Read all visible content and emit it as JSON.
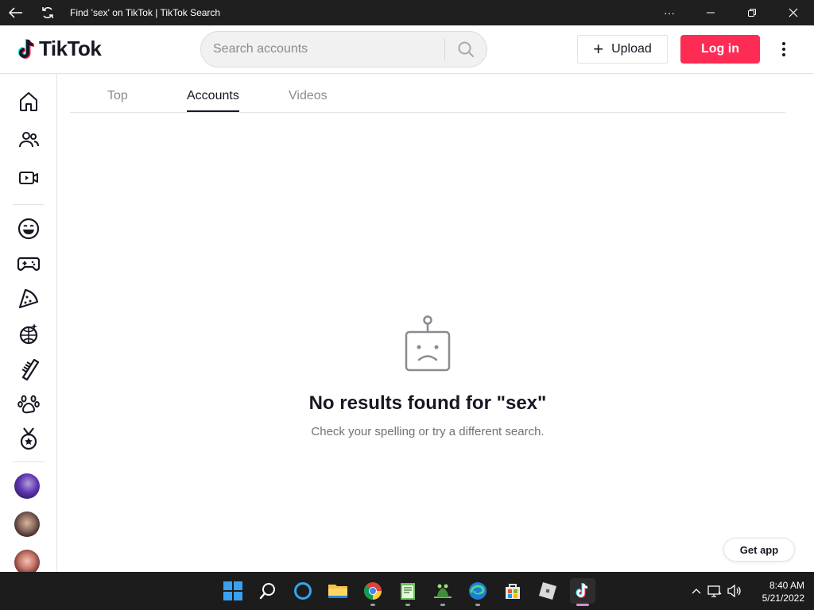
{
  "window": {
    "title": "Find 'sex' on TikTok | TikTok Search"
  },
  "header": {
    "logo_text": "TikTok",
    "search_placeholder": "Search accounts",
    "upload_label": "Upload",
    "login_label": "Log in"
  },
  "tabs": [
    {
      "label": "Top",
      "active": false
    },
    {
      "label": "Accounts",
      "active": true
    },
    {
      "label": "Videos",
      "active": false
    }
  ],
  "sidebar": {
    "items": [
      {
        "icon": "home-icon"
      },
      {
        "icon": "following-icon"
      },
      {
        "icon": "live-icon"
      },
      {
        "icon": "comedy-icon"
      },
      {
        "icon": "gaming-icon"
      },
      {
        "icon": "food-icon"
      },
      {
        "icon": "dance-icon"
      },
      {
        "icon": "beauty-icon"
      },
      {
        "icon": "animals-icon"
      },
      {
        "icon": "sports-icon"
      }
    ]
  },
  "empty_state": {
    "title": "No results found for \"sex\"",
    "subtitle": "Check your spelling or try a different search."
  },
  "get_app_label": "Get app",
  "taskbar": {
    "time": "8:40 AM",
    "date": "5/21/2022"
  },
  "colors": {
    "brand_red": "#fe2c55",
    "text_primary": "#161823",
    "text_muted": "#8a8b91",
    "border": "#e3e3e4"
  }
}
